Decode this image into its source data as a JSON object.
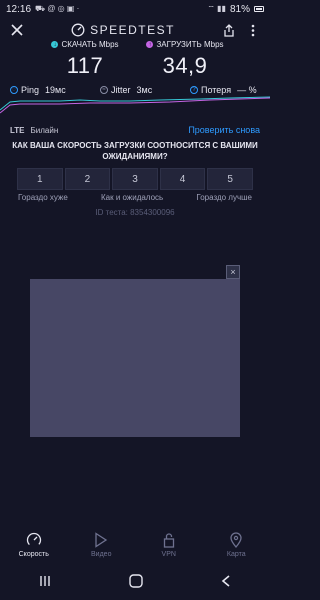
{
  "status_bar": {
    "time": "12:16",
    "battery": "81%"
  },
  "header": {
    "title": "SPEEDTEST"
  },
  "metrics": {
    "download": {
      "label": "СКАЧАТЬ Mbps",
      "value": "117",
      "color": "#37c8d6"
    },
    "upload": {
      "label": "ЗАГРУЗИТЬ Mbps",
      "value": "34,9",
      "color": "#c465e4"
    }
  },
  "stats": {
    "ping": {
      "label": "Ping",
      "value": "19мс"
    },
    "jitter": {
      "label": "Jitter",
      "value": "3мс"
    },
    "loss": {
      "label": "Потеря",
      "value": "— %"
    }
  },
  "network": {
    "type": "LTE",
    "provider": "Билайн",
    "retry_label": "Проверить снова"
  },
  "survey": {
    "question": "КАК ВАША СКОРОСТЬ ЗАГРУЗКИ СООТНОСИТСЯ С ВАШИМИ ОЖИДАНИЯМИ?",
    "options": [
      "1",
      "2",
      "3",
      "4",
      "5"
    ],
    "label_low": "Гораздо хуже",
    "label_mid": "Как и ожидалось",
    "label_high": "Гораздо лучше"
  },
  "test_id": "ID теста: 8354300096",
  "ad": {
    "close_glyph": "×"
  },
  "bottom_nav": {
    "items": [
      {
        "label": "Скорость",
        "icon": "speedometer-icon",
        "active": true
      },
      {
        "label": "Видео",
        "icon": "play-icon",
        "active": false
      },
      {
        "label": "VPN",
        "icon": "lock-icon",
        "active": false
      },
      {
        "label": "Карта",
        "icon": "map-pin-icon",
        "active": false
      }
    ]
  },
  "colors": {
    "background": "#141526",
    "accent_blue": "#2e9bff",
    "download": "#37c8d6",
    "upload": "#c465e4"
  }
}
